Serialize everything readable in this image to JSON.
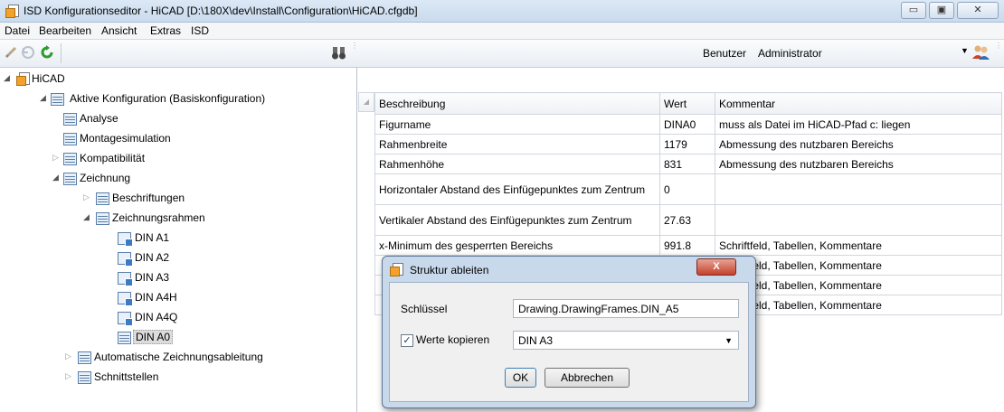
{
  "window": {
    "title": "ISD Konfigurationseditor  - HiCAD [D:\\180X\\dev\\Install\\Configuration\\HiCAD.cfgdb]",
    "minimize_glyph": "▭",
    "maximize_glyph": "▣",
    "close_glyph": "✕"
  },
  "menu": [
    "Datei",
    "Bearbeiten",
    "Ansicht",
    "Extras",
    "ISD"
  ],
  "toolbar": {
    "user_label": "Benutzer",
    "user_value": "Administrator",
    "icons": [
      "pencil-icon",
      "undo-icon",
      "refresh-icon",
      "binoculars-icon",
      "users-icon"
    ]
  },
  "tree": {
    "root": "HiCAD",
    "active": "Aktive Konfiguration (Basiskonfiguration)",
    "analyse": "Analyse",
    "montage": "Montagesimulation",
    "kompat": "Kompatibilität",
    "zeichnung": "Zeichnung",
    "beschriftungen": "Beschriftungen",
    "rahmen": "Zeichnungsrahmen",
    "a1": "DIN A1",
    "a2": "DIN A2",
    "a3": "DIN A3",
    "a4h": "DIN A4H",
    "a4q": "DIN A4Q",
    "a0": "DIN A0",
    "autozeich": "Automatische Zeichnungsableitung",
    "schnitt": "Schnittstellen"
  },
  "grid": {
    "headers": [
      "Beschreibung",
      "Wert",
      "Kommentar"
    ],
    "rows": [
      {
        "desc": "Figurname",
        "value": "DINA0",
        "comment": "muss als Datei im HiCAD-Pfad c: liegen"
      },
      {
        "desc": "Rahmenbreite",
        "value": "1179",
        "comment": "Abmessung des nutzbaren Bereichs"
      },
      {
        "desc": "Rahmenhöhe",
        "value": "831",
        "comment": "Abmessung des nutzbaren Bereichs"
      },
      {
        "desc": "Horizontaler Abstand des Einfügepunktes zum Zentrum",
        "value": "0",
        "comment": ""
      },
      {
        "desc": "Vertikaler Abstand des Einfügepunktes zum Zentrum",
        "value": "27.63",
        "comment": ""
      },
      {
        "desc": "x-Minimum des gesperrten Bereichs",
        "value": "991.8",
        "comment": "Schriftfeld, Tabellen, Kommentare"
      },
      {
        "desc": "",
        "value": "",
        "comment": "Schriftfeld, Tabellen, Kommentare"
      },
      {
        "desc": "",
        "value": "",
        "comment": "Schriftfeld, Tabellen, Kommentare"
      },
      {
        "desc": "",
        "value": "",
        "comment": "Schriftfeld, Tabellen, Kommentare"
      }
    ]
  },
  "dialog": {
    "title": "Struktur ableiten",
    "close_glyph": "X",
    "key_label": "Schlüssel",
    "key_value": "Drawing.DrawingFrames.DIN_A5",
    "copy_label": "Werte kopieren",
    "copy_checked_glyph": "✓",
    "copy_select_value": "DIN A3",
    "ok_label": "OK",
    "cancel_label": "Abbrechen"
  }
}
